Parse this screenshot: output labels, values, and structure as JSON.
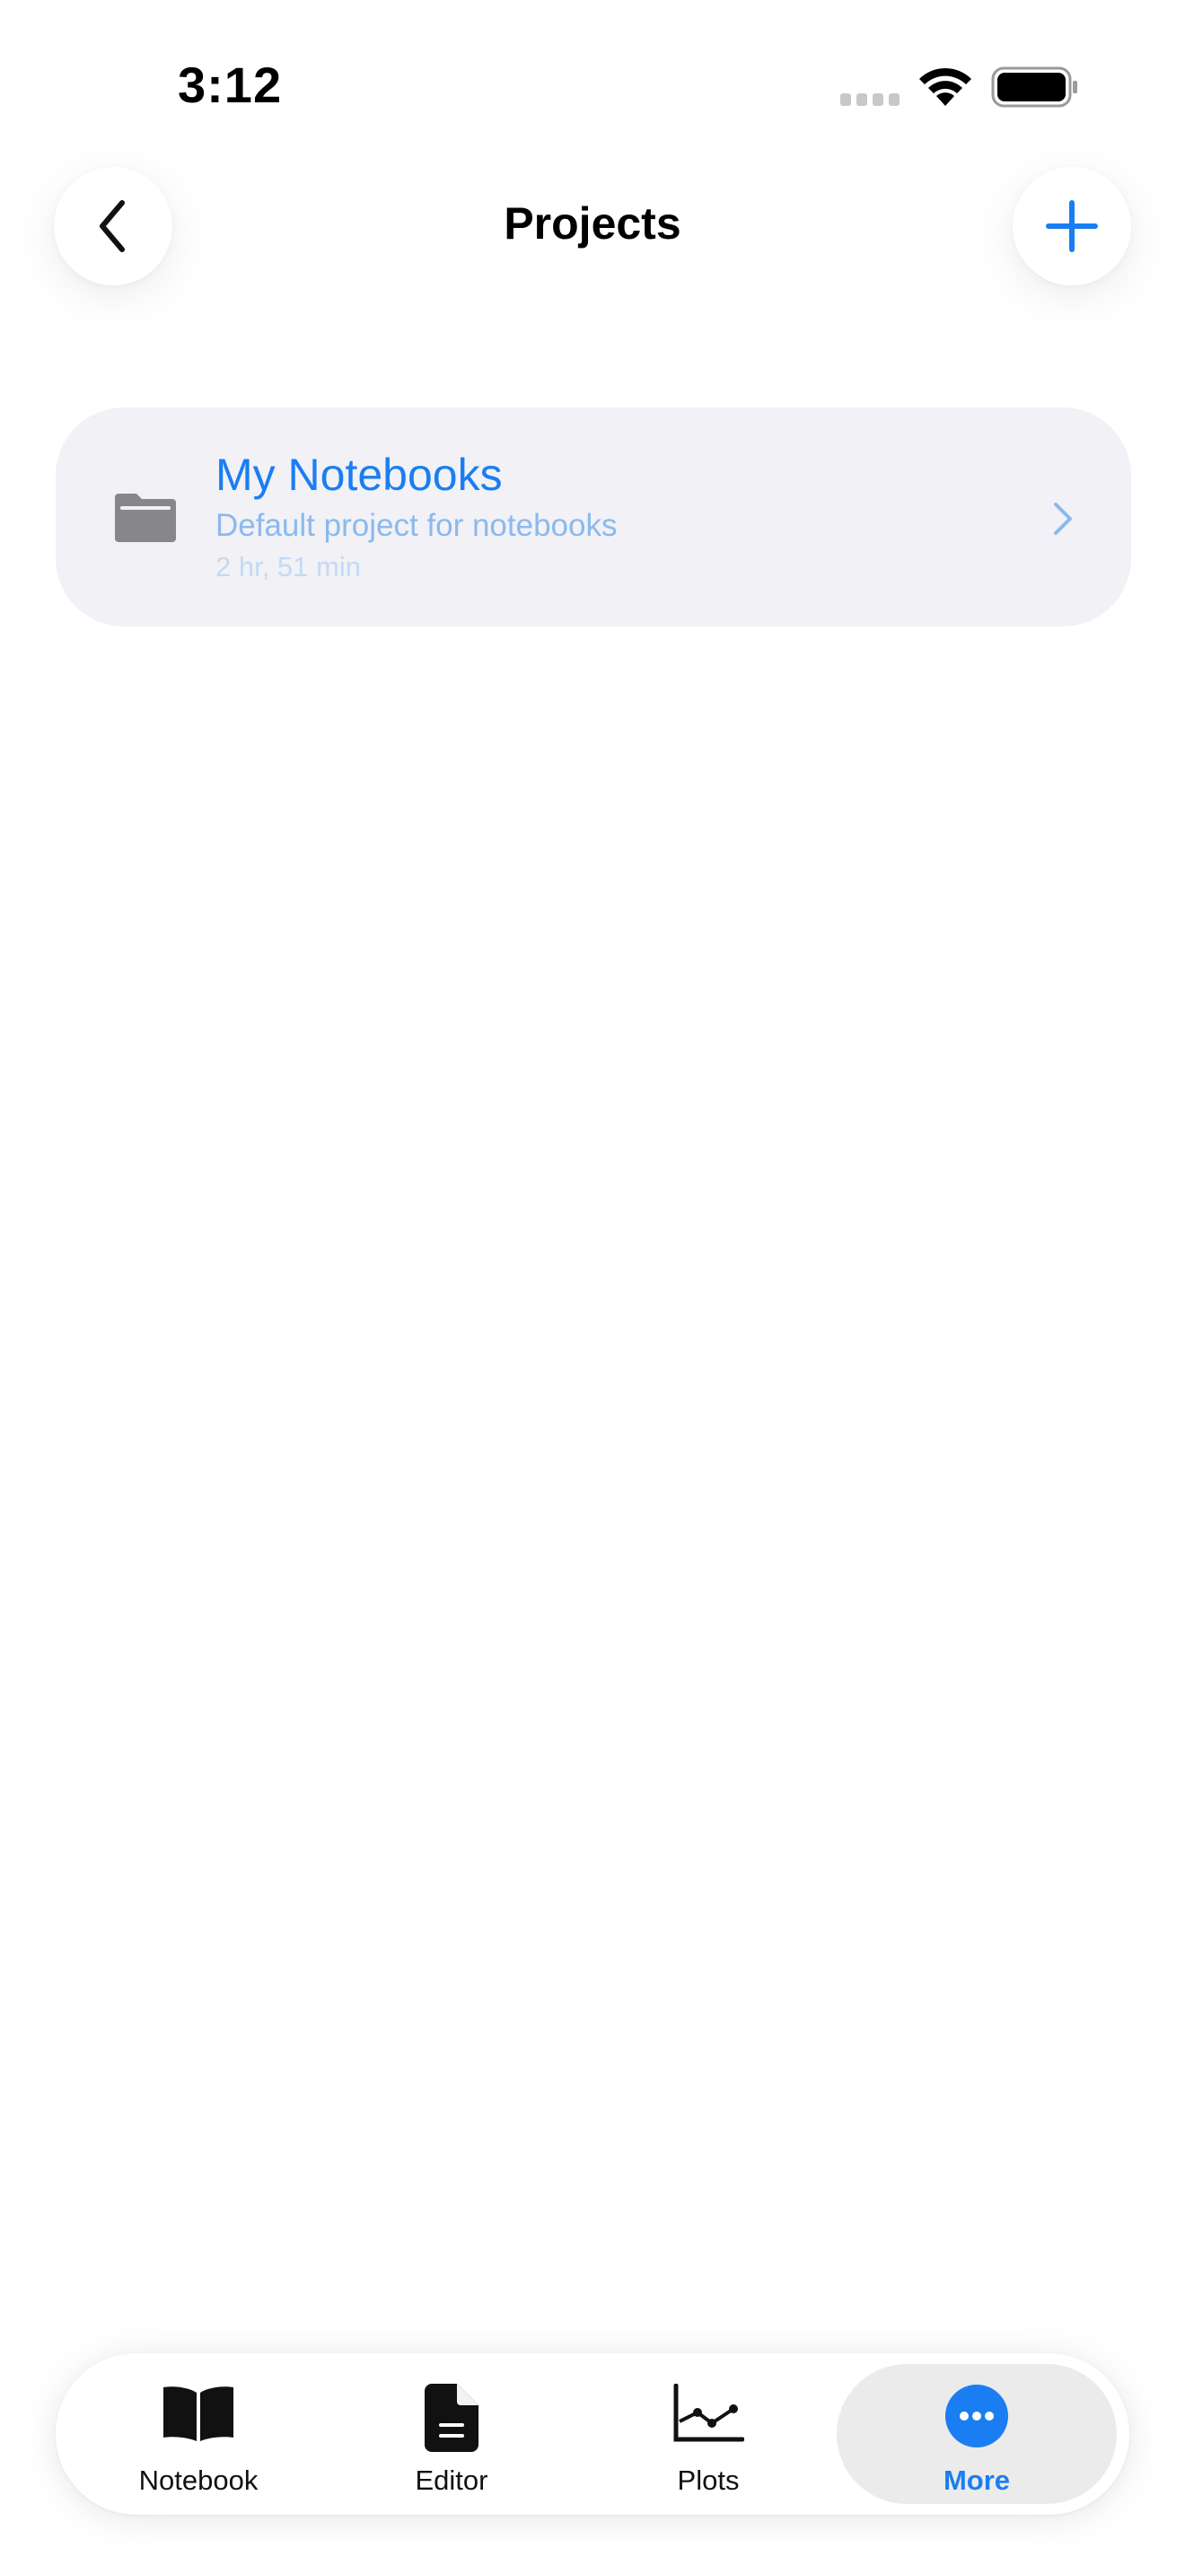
{
  "status_bar": {
    "time": "3:12"
  },
  "header": {
    "title": "Projects",
    "back_icon": "chevron-left-icon",
    "add_icon": "plus-icon"
  },
  "projects": [
    {
      "name": "My Notebooks",
      "description": "Default project for notebooks",
      "meta": "2 hr, 51 min",
      "icon": "folder-icon"
    }
  ],
  "tab_bar": {
    "tabs": [
      {
        "label": "Notebook",
        "icon": "book-icon",
        "selected": false
      },
      {
        "label": "Editor",
        "icon": "document-icon",
        "selected": false
      },
      {
        "label": "Plots",
        "icon": "line-chart-icon",
        "selected": false
      },
      {
        "label": "More",
        "icon": "ellipsis-circle-icon",
        "selected": true
      }
    ]
  },
  "colors": {
    "accent": "#1a7ef2",
    "card_background": "#f1f1f6",
    "selected_tab_background": "#ebebeb"
  }
}
